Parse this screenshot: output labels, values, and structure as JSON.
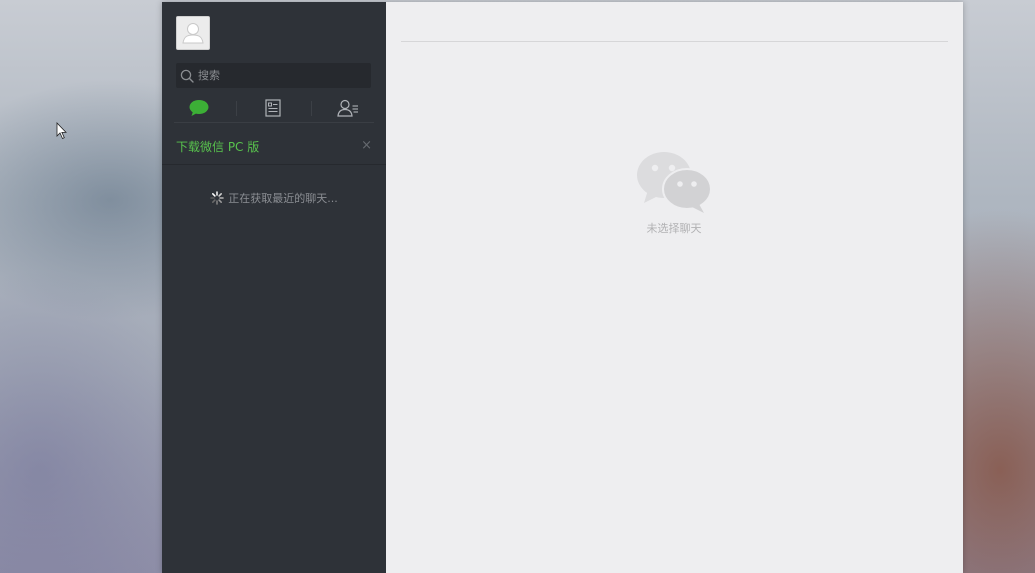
{
  "sidebar": {
    "search": {
      "placeholder": "搜索"
    },
    "tabs": [
      {
        "icon": "chat-bubble-icon",
        "active": true,
        "active_color": "#3caf36"
      },
      {
        "icon": "article-icon",
        "active": false
      },
      {
        "icon": "contacts-icon",
        "active": false
      }
    ],
    "banner": {
      "label": "下载微信 PC 版",
      "close_symbol": "×",
      "color": "#58c24d"
    },
    "loading_text": "正在获取最近的聊天..."
  },
  "main": {
    "empty_text": "未选择聊天",
    "empty_icon": "wechat-logo-icon"
  },
  "colors": {
    "sidebar_bg": "#2e3238",
    "main_bg": "#eeeef0",
    "accent": "#3caf36"
  }
}
